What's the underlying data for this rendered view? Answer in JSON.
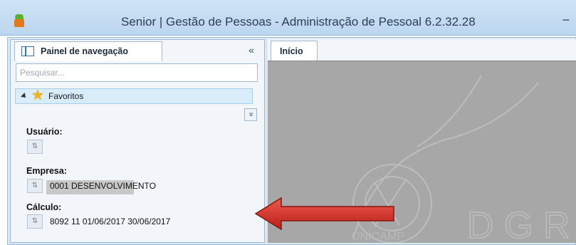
{
  "window": {
    "title": "Senior | Gestão de Pessoas - Administração de Pessoal 6.2.32.28",
    "minimize_symbol": "−"
  },
  "nav_panel": {
    "tab_label": "Painel de navegação",
    "collapse_symbol": "«",
    "search_placeholder": "Pesquisar...",
    "favorites_label": "Favoritos",
    "expand_symbol": "»",
    "user_label": "Usuário:",
    "company_label": "Empresa:",
    "company_value": "0001  DESENVOLVIMENTO",
    "calc_label": "Cálculo:",
    "calc_value": "8092  11  01/06/2017  30/06/2017"
  },
  "work_area": {
    "tab_label": "Início",
    "watermark_text": "D G R",
    "watermark_subtext": "UNICAMP"
  },
  "colors": {
    "arrow": "#d9322a",
    "canvas": "#a7a7a7",
    "titlebar": "#c6dcf2"
  },
  "icons": [
    "app-logo-icon",
    "navigation-panel-icon",
    "star-icon",
    "context-button-icon"
  ]
}
